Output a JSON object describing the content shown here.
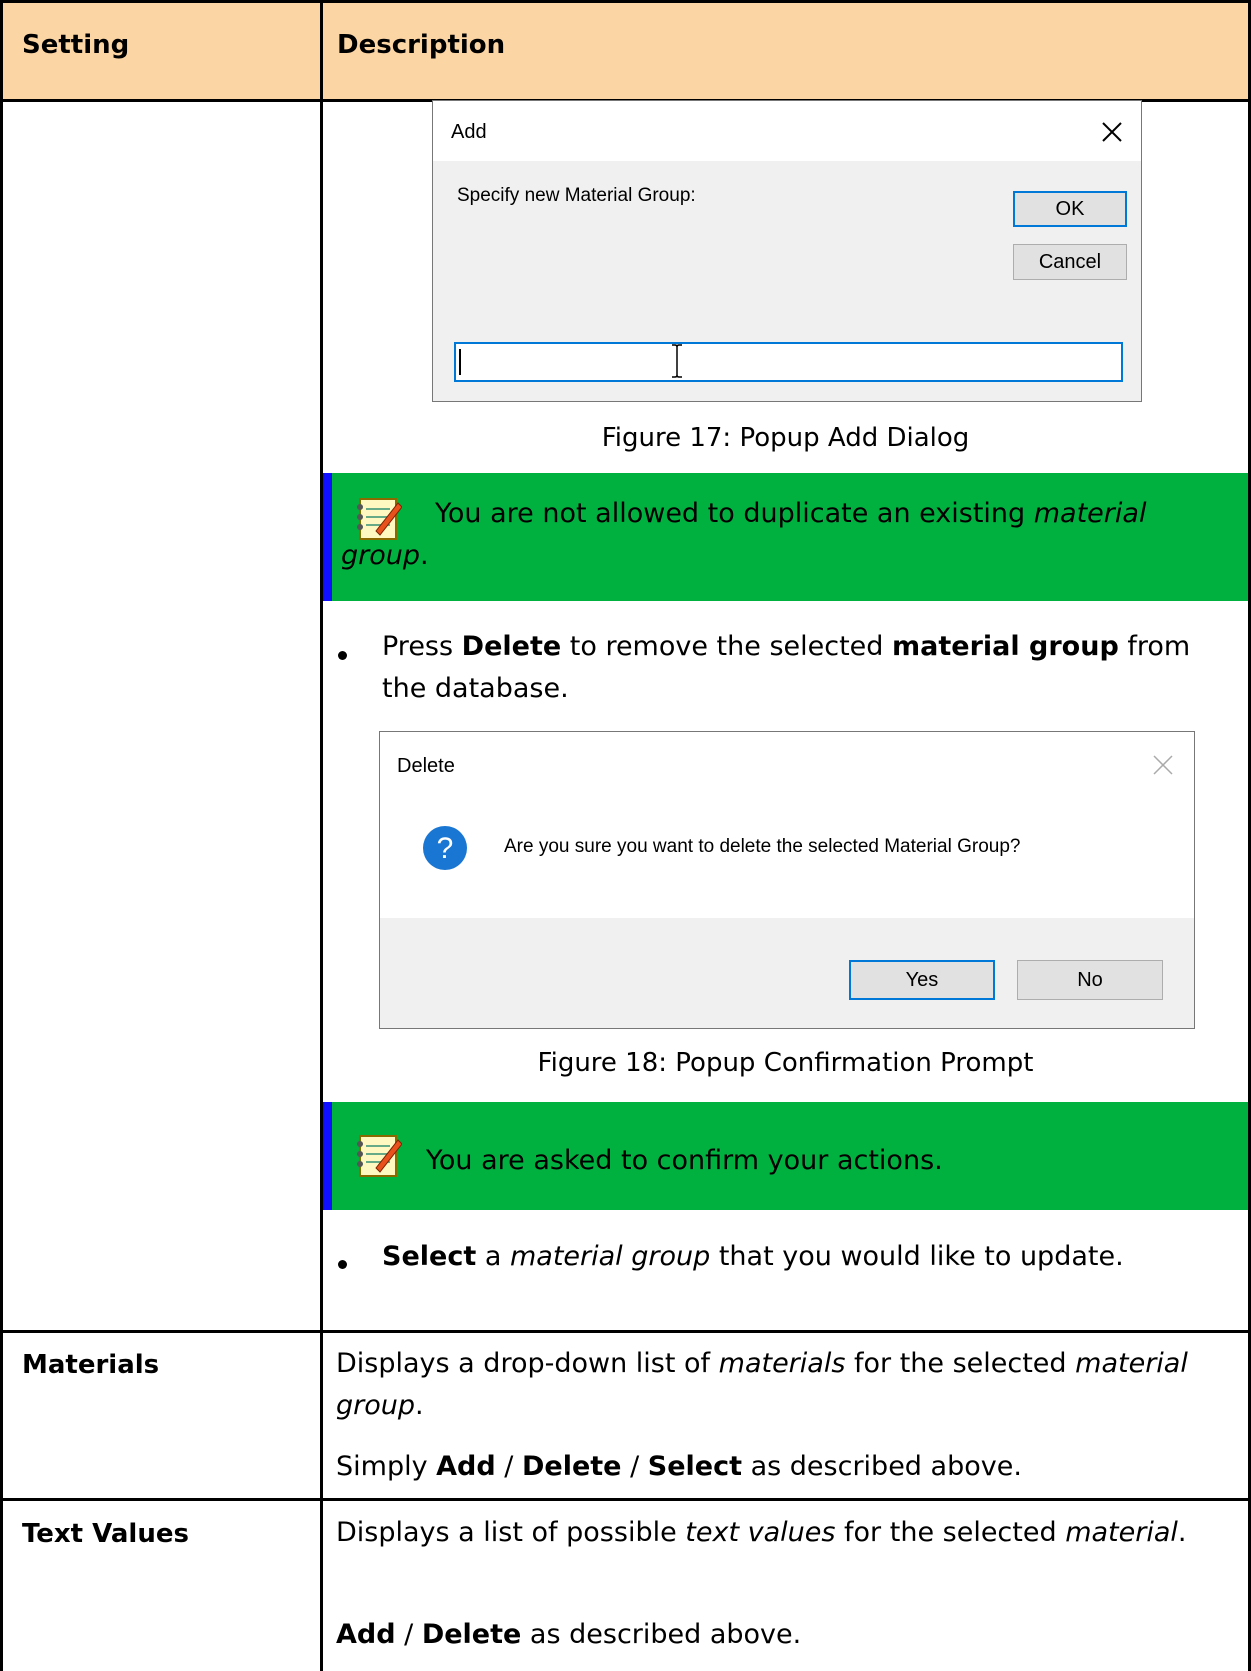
{
  "header": {
    "col1": "Setting",
    "col2": "Description"
  },
  "add_dialog": {
    "title": "Add",
    "prompt": "Specify new Material Group:",
    "ok_label": "OK",
    "cancel_label": "Cancel",
    "input_value": "",
    "caption": "Figure 17: Popup Add Dialog"
  },
  "note1": {
    "text_before": "You are not allowed to duplicate an existing ",
    "text_italic": "material group",
    "text_after": "."
  },
  "bullet_delete": {
    "t1": "Press ",
    "b1": "Delete",
    "t2": " to remove the selected ",
    "b2": "material group",
    "t3": " from the database."
  },
  "delete_dialog": {
    "title": "Delete",
    "message": "Are you sure you want to delete the selected Material Group?",
    "yes_label": "Yes",
    "no_label": "No",
    "caption": "Figure 18: Popup Confirmation Prompt"
  },
  "note2": {
    "text": "You are asked to confirm your actions."
  },
  "bullet_select": {
    "b1": "Select",
    "t1": " a ",
    "i1": "material group",
    "t2": " that you would like to update."
  },
  "row_materials": {
    "label": "Materials",
    "t1": "Displays a drop-down list of ",
    "i1": "materials",
    "t2": " for the selected ",
    "i2": "material group",
    "t3": ".",
    "s1": "Simply ",
    "sb1": "Add",
    "s2": " / ",
    "sb2": "Delete",
    "s3": " / ",
    "sb3": "Select",
    "s4": " as described above."
  },
  "row_text_values": {
    "label": "Text Values",
    "t1": "Displays a list of possible ",
    "i1": "text values",
    "t2": " for the selected ",
    "i2": "material",
    "t3": ".",
    "sb1": "Add",
    "s1": " / ",
    "sb2": "Delete",
    "s2": " as described above."
  },
  "colors": {
    "header_bg": "#fcd5a4",
    "note_bg": "#00b140",
    "note_bar": "#1010ff"
  }
}
